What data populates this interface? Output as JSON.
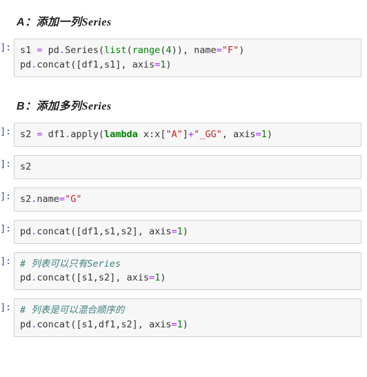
{
  "headings": {
    "a_prefix": "A：添加一列",
    "a_suffix": "Series",
    "b_prefix": "B：添加多列",
    "b_suffix": "Series"
  },
  "prompt": "]:",
  "cells": {
    "c0": {
      "l0": {
        "a": "s1 ",
        "b": "=",
        "c": " pd",
        "d": ".",
        "e": "Series",
        "f": "(",
        "g": "list",
        "h": "(",
        "i": "range",
        "j": "(",
        "k": "4",
        "l": ")), name",
        "m": "=",
        "n": "\"F\"",
        "o": ")"
      },
      "l1": {
        "a": "pd",
        "b": ".",
        "c": "concat",
        "d": "([df1,s1], axis",
        "e": "=",
        "f": "1",
        "g": ")"
      }
    },
    "c1": {
      "l0": {
        "a": "s2 ",
        "b": "=",
        "c": " df1",
        "d": ".",
        "e": "apply",
        "f": "(",
        "g": "lambda",
        "h": " x:x[",
        "i": "\"A\"",
        "j": "]",
        "k": "+",
        "l": "\"_GG\"",
        "m": ", axis",
        "n": "=",
        "o": "1",
        "p": ")"
      }
    },
    "c2": {
      "l0": {
        "a": "s2"
      }
    },
    "c3": {
      "l0": {
        "a": "s2",
        "b": ".",
        "c": "name",
        "d": "=",
        "e": "\"G\""
      }
    },
    "c4": {
      "l0": {
        "a": "pd",
        "b": ".",
        "c": "concat",
        "d": "([df1,s1,s2], axis",
        "e": "=",
        "f": "1",
        "g": ")"
      }
    },
    "c5": {
      "l0": {
        "a": "# 列表可以只有Series"
      },
      "l1": {
        "a": "pd",
        "b": ".",
        "c": "concat",
        "d": "([s1,s2], axis",
        "e": "=",
        "f": "1",
        "g": ")"
      }
    },
    "c6": {
      "l0": {
        "a": "# 列表是可以混合顺序的"
      },
      "l1": {
        "a": "pd",
        "b": ".",
        "c": "concat",
        "d": "([s1,df1,s2], axis",
        "e": "=",
        "f": "1",
        "g": ")"
      }
    }
  }
}
